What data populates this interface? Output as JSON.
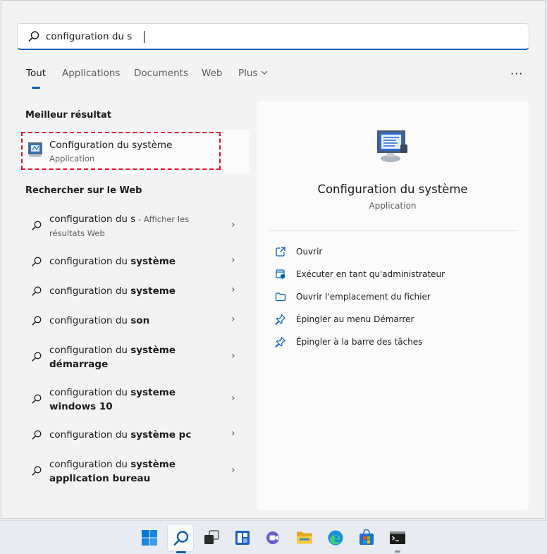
{
  "search": {
    "value": "configuration du s",
    "placeholder": ""
  },
  "tabs": [
    {
      "label": "Tout",
      "active": true
    },
    {
      "label": "Applications"
    },
    {
      "label": "Documents"
    },
    {
      "label": "Web"
    },
    {
      "label": "Plus"
    }
  ],
  "more_options": "···",
  "best_match": {
    "section_title": "Meilleur résultat",
    "name": "Configuration du système",
    "type": "Application"
  },
  "web": {
    "section_title": "Rechercher sur le Web",
    "items": [
      {
        "prefix": "configuration du s",
        "bold": "",
        "suffix": " - Afficher les résultats Web"
      },
      {
        "prefix": "configuration du ",
        "bold": "système",
        "suffix": ""
      },
      {
        "prefix": "configuration du ",
        "bold": "systeme",
        "suffix": ""
      },
      {
        "prefix": "configuration du ",
        "bold": "son",
        "suffix": ""
      },
      {
        "prefix": "configuration du ",
        "bold": "système démarrage",
        "suffix": ""
      },
      {
        "prefix": "configuration du ",
        "bold": "systeme windows 10",
        "suffix": ""
      },
      {
        "prefix": "configuration du ",
        "bold": "système pc",
        "suffix": ""
      },
      {
        "prefix": "configuration du ",
        "bold": "système application bureau",
        "suffix": ""
      }
    ]
  },
  "detail": {
    "title": "Configuration du système",
    "type": "Application",
    "actions": [
      {
        "label": "Ouvrir",
        "icon": "open-icon"
      },
      {
        "label": "Exécuter en tant qu'administrateur",
        "icon": "shield-icon"
      },
      {
        "label": "Ouvrir l'emplacement du fichier",
        "icon": "folder-icon"
      },
      {
        "label": "Épingler au menu Démarrer",
        "icon": "pin-icon"
      },
      {
        "label": "Épingler à la barre des tâches",
        "icon": "pin-icon"
      }
    ]
  },
  "taskbar": {
    "apps": [
      "windows-start-icon",
      "search-icon",
      "task-view-icon",
      "widgets-icon",
      "teams-chat-icon",
      "file-explorer-icon",
      "edge-icon",
      "store-icon",
      "terminal-icon"
    ]
  },
  "colors": {
    "accent": "#005fb8",
    "highlight_outline": "#e81123"
  }
}
